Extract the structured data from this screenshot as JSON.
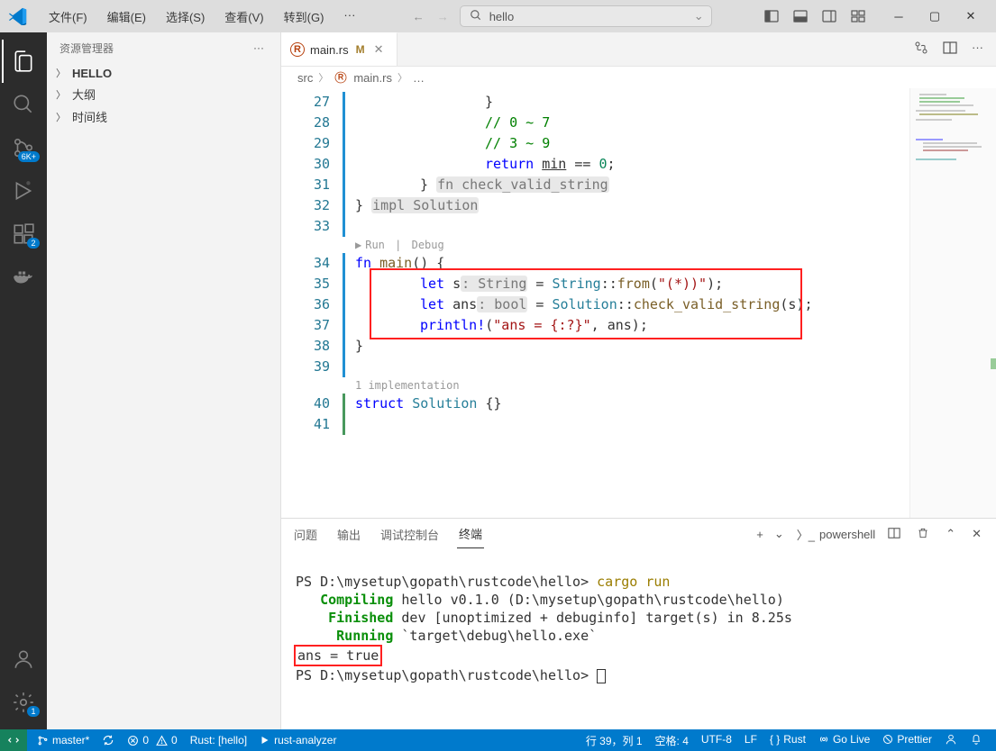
{
  "menu": {
    "file": "文件(F)",
    "edit": "编辑(E)",
    "select": "选择(S)",
    "view": "查看(V)",
    "goto": "转到(G)",
    "more": "···"
  },
  "search": {
    "placeholder": "hello"
  },
  "sidebar": {
    "title": "资源管理器",
    "items": [
      {
        "label": "HELLO",
        "bold": true
      },
      {
        "label": "大纲"
      },
      {
        "label": "时间线"
      }
    ]
  },
  "activity": {
    "scm_badge": "6K+",
    "ext_badge": "2",
    "settings_badge": "1"
  },
  "tab": {
    "filename": "main.rs",
    "modified": "M"
  },
  "breadcrumb": {
    "folder": "src",
    "file": "main.rs",
    "more": "…"
  },
  "code": {
    "lines": [
      {
        "n": 27,
        "indent": 16,
        "html": "}"
      },
      {
        "n": 28,
        "indent": 16,
        "html": "<span class='cm'>// 0 ~ 7</span>"
      },
      {
        "n": 29,
        "indent": 16,
        "html": "<span class='cm'>// 3 ~ 9</span>"
      },
      {
        "n": 30,
        "indent": 16,
        "html": "<span class='kw'>return</span> <u>min</u> == <span class='nm'>0</span>;"
      },
      {
        "n": 31,
        "indent": 8,
        "html": "} <span class='inl'>fn check_valid_string</span>"
      },
      {
        "n": 32,
        "indent": 0,
        "html": "} <span class='inl'>impl Solution</span>"
      },
      {
        "n": 33,
        "indent": 0,
        "html": ""
      }
    ],
    "codelens_run": "Run",
    "codelens_debug": "Debug",
    "main": [
      {
        "n": 34,
        "indent": 0,
        "html": "<span class='kw'>fn</span> <span class='fn'>main</span>() {"
      },
      {
        "n": 35,
        "indent": 8,
        "html": "<span class='kw'>let</span> s<span class='inl'>: String</span> = <span class='ty'>String</span>::<span class='fn'>from</span>(<span class='st'>\"(*))\"</span>);"
      },
      {
        "n": 36,
        "indent": 8,
        "html": "<span class='kw'>let</span> ans<span class='inl'>: bool</span> = <span class='ty'>Solution</span>::<span class='fn'>check_valid_string</span>(s);"
      },
      {
        "n": 37,
        "indent": 8,
        "html": "<span class='mac'>println!</span>(<span class='st'>\"ans = {:?}\"</span>, ans);"
      },
      {
        "n": 38,
        "indent": 0,
        "html": "}"
      },
      {
        "n": 39,
        "indent": 0,
        "html": ""
      }
    ],
    "codelens_impl": "1 implementation",
    "tail": [
      {
        "n": 40,
        "indent": 0,
        "green": true,
        "html": "<span class='kw'>struct</span> <span class='ty'>Solution</span> {}"
      },
      {
        "n": 41,
        "indent": 0,
        "green": true,
        "html": ""
      }
    ]
  },
  "panel": {
    "tabs": {
      "problems": "问题",
      "output": "输出",
      "debug": "调试控制台",
      "terminal": "终端"
    },
    "shell": "powershell"
  },
  "terminal": {
    "l1_prompt": "PS D:\\mysetup\\gopath\\rustcode\\hello> ",
    "l1_cmd": "cargo run",
    "l2_kw": "Compiling",
    "l2_rest": " hello v0.1.0 (D:\\mysetup\\gopath\\rustcode\\hello)",
    "l3_kw": "Finished",
    "l3_rest": " dev [unoptimized + debuginfo] target(s) in 8.25s",
    "l4_kw": "Running",
    "l4_rest": " `target\\debug\\hello.exe`",
    "l5_out": "ans = true",
    "l6_prompt": "PS D:\\mysetup\\gopath\\rustcode\\hello> "
  },
  "status": {
    "branch": "master*",
    "sync": "",
    "errors": "0",
    "warnings": "0",
    "rust": "Rust: [hello]",
    "ra": "rust-analyzer",
    "pos": "行 39，列 1",
    "spaces": "空格: 4",
    "enc": "UTF-8",
    "eol": "LF",
    "lang": "Rust",
    "golive": "Go Live",
    "prettier": "Prettier"
  }
}
